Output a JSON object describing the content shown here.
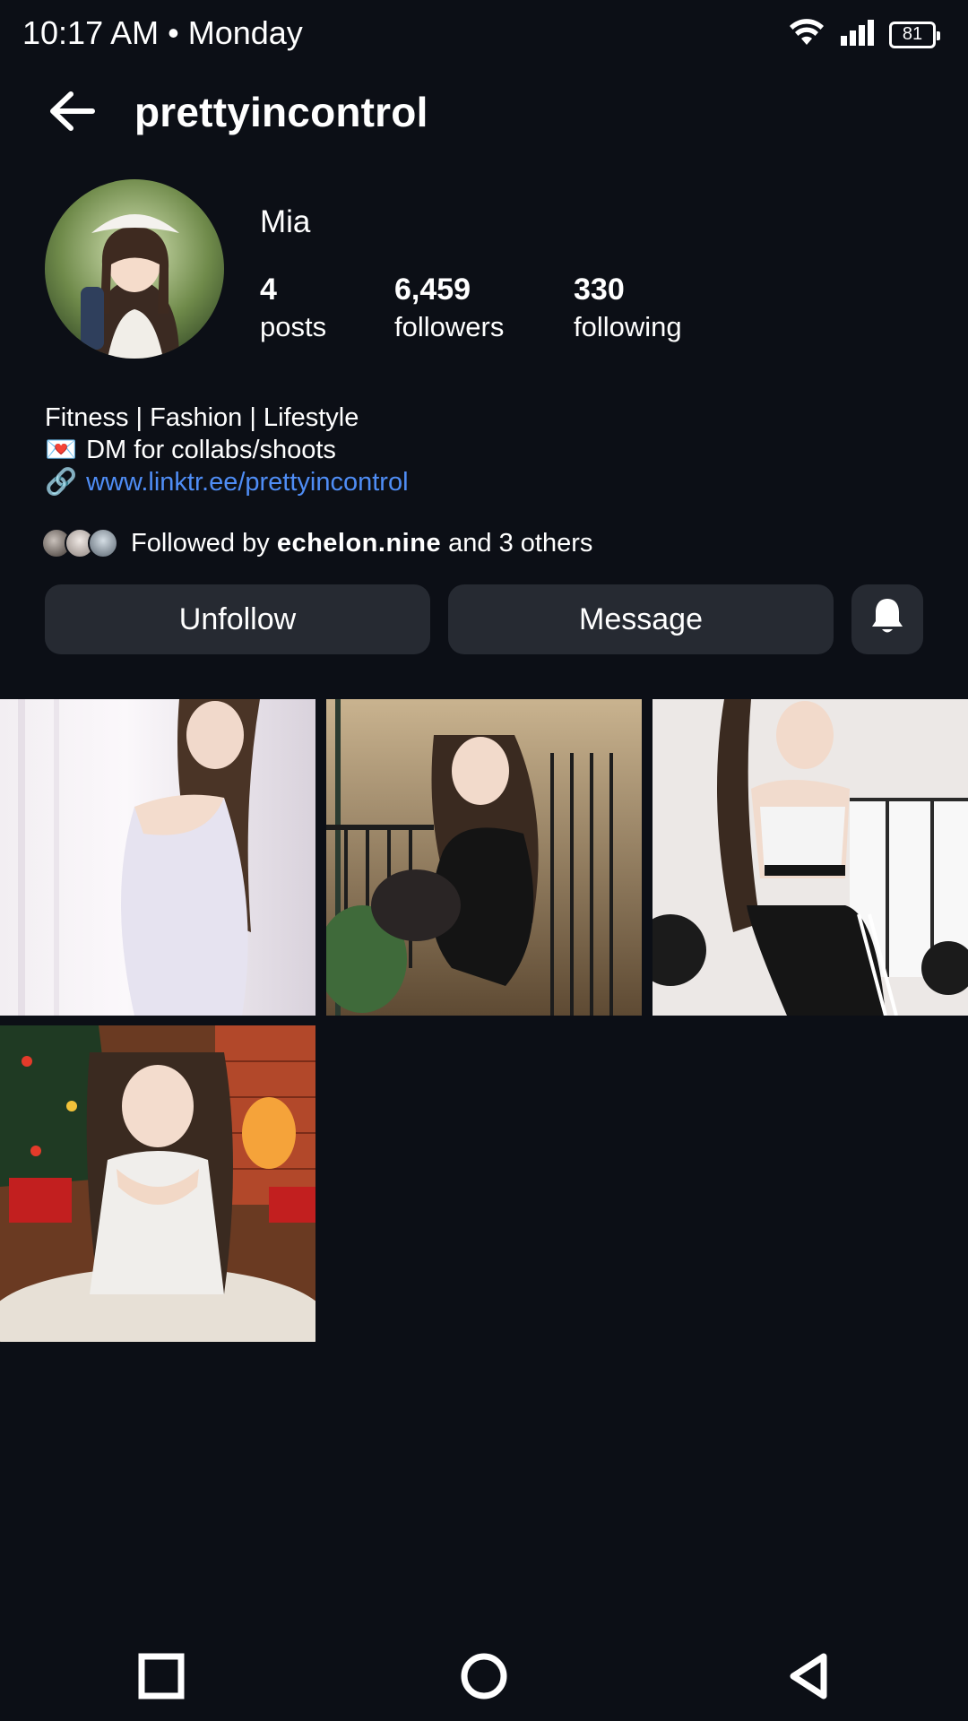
{
  "status_bar": {
    "time": "10:17 AM • Monday",
    "battery": "81"
  },
  "header": {
    "username": "prettyincontrol"
  },
  "profile": {
    "display_name": "Mia",
    "stats": [
      {
        "value": "4",
        "label": "posts"
      },
      {
        "value": "6,459",
        "label": "followers"
      },
      {
        "value": "330",
        "label": "following"
      }
    ],
    "bio": {
      "line1": "Fitness | Fashion | Lifestyle",
      "line2_icon": "💌",
      "line2": "DM for collabs/shoots",
      "line3_icon": "🔗",
      "link": "www.linktr.ee/prettyincontrol"
    },
    "followed_by": {
      "prefix": "Followed by",
      "name": "echelon.nine",
      "suffix": "and 3 others"
    }
  },
  "actions": {
    "unfollow": "Unfollow",
    "message": "Message"
  },
  "icons": {
    "back": "arrow-left-icon",
    "notifications": "bell-icon",
    "wifi": "wifi-icon",
    "signal": "signal-icon",
    "battery": "battery-icon",
    "nav_recents": "square-icon",
    "nav_home": "circle-icon",
    "nav_back": "triangle-back-icon"
  },
  "colors": {
    "background": "#0c0f16",
    "button": "#262a32",
    "link": "#4f8df5"
  },
  "posts": [
    {
      "id": "post-1",
      "scene": "white dress by curtains"
    },
    {
      "id": "post-2",
      "scene": "black dress on balcony"
    },
    {
      "id": "post-3",
      "scene": "gym outfit by window"
    },
    {
      "id": "post-4",
      "scene": "sweater by christmas tree"
    }
  ]
}
